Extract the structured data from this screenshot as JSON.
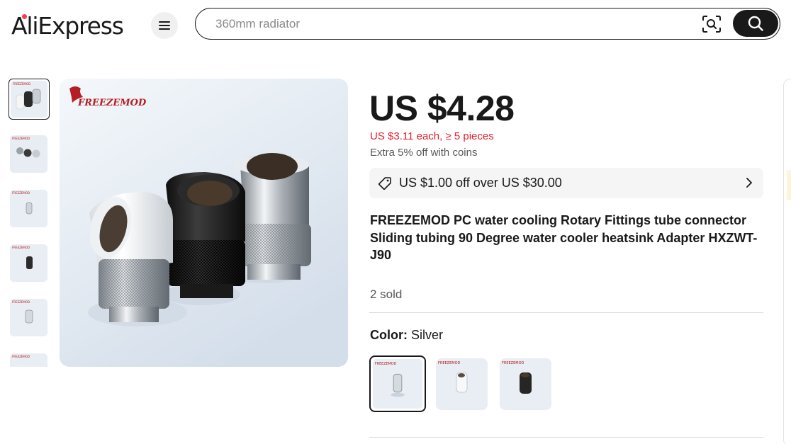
{
  "header": {
    "logo_text": "AliExpress",
    "search_placeholder": "360mm radiator",
    "menu_icon": "hamburger-icon",
    "camera_icon": "image-search-icon",
    "search_icon": "search-icon"
  },
  "gallery": {
    "brand_watermark": "FREEZEMOD",
    "thumbnails": [
      {
        "variant": "white-black-silver"
      },
      {
        "variant": "grey-mixed"
      },
      {
        "variant": "silver"
      },
      {
        "variant": "black"
      },
      {
        "variant": "silver-alt"
      },
      {
        "variant": "partial"
      }
    ]
  },
  "product": {
    "price": "US $4.28",
    "bulk_price": "US $3.11 each, ≥ 5 pieces",
    "coins_note": "Extra 5% off with coins",
    "coupon_text": "US $1.00 off over US $30.00",
    "title": "FREEZEMOD PC water cooling Rotary Fittings tube connector Sliding tubing 90 Degree water cooler heatsink Adapter HXZWT-J90",
    "sold": "2 sold",
    "color_label": "Color:",
    "color_value": "Silver",
    "color_options": [
      "Silver",
      "White",
      "Black"
    ]
  },
  "colors": {
    "accent_red": "#e6202d",
    "text_dark": "#191919",
    "text_muted": "#595959",
    "coupon_bg": "#f5f5f5"
  }
}
